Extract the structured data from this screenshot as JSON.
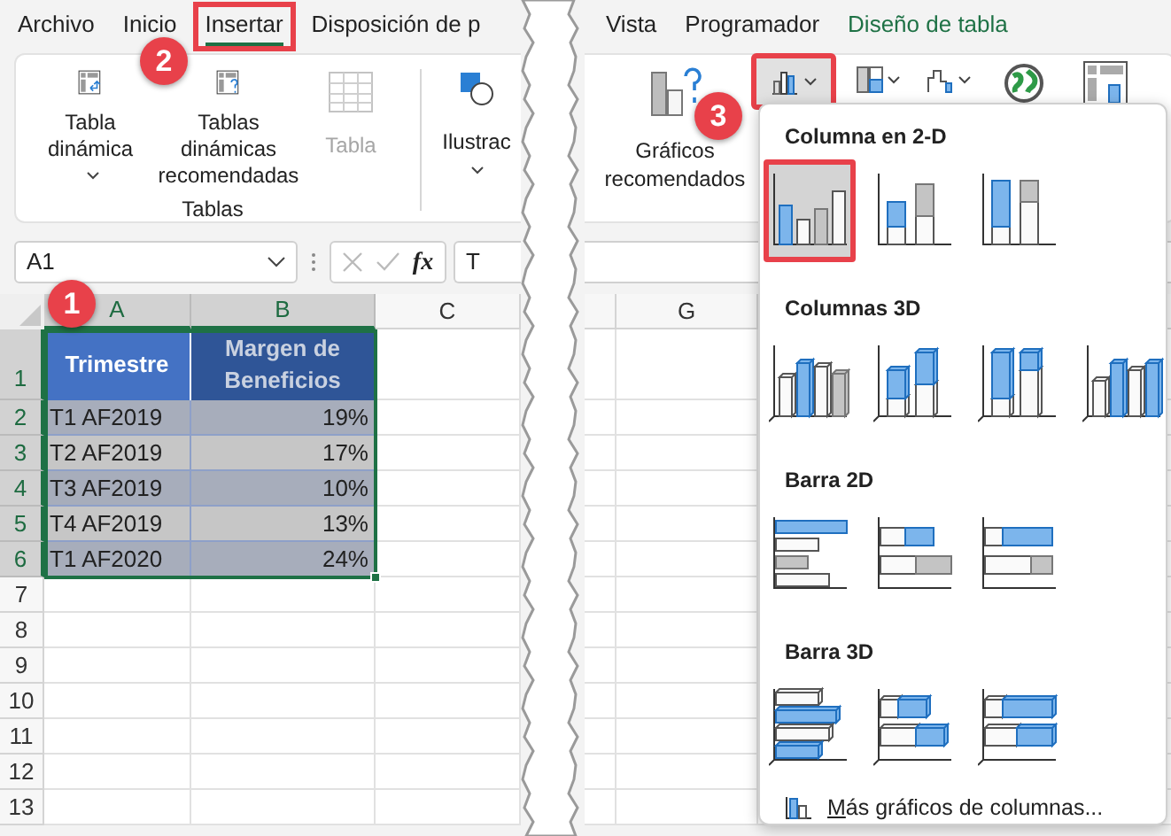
{
  "tabs": [
    {
      "label": "Archivo",
      "selected": false,
      "highlighted": false,
      "kind": "normal"
    },
    {
      "label": "Inicio",
      "selected": false,
      "highlighted": false,
      "kind": "normal"
    },
    {
      "label": "Insertar",
      "selected": true,
      "highlighted": true,
      "kind": "normal"
    },
    {
      "label": "Disposición de p",
      "selected": false,
      "highlighted": false,
      "kind": "normal"
    },
    {
      "label": "Vista",
      "selected": false,
      "highlighted": false,
      "kind": "normal"
    },
    {
      "label": "Programador",
      "selected": false,
      "highlighted": false,
      "kind": "normal"
    },
    {
      "label": "Diseño de tabla",
      "selected": false,
      "highlighted": false,
      "kind": "contextual"
    }
  ],
  "ribbon": {
    "tables_group": {
      "label": "Tablas",
      "buttons": [
        {
          "label": "Tabla dinámica",
          "dropdown": true,
          "disabled": false
        },
        {
          "label": "Tablas dinámicas recomendadas",
          "dropdown": false,
          "disabled": false
        },
        {
          "label": "Tabla",
          "dropdown": false,
          "disabled": true
        }
      ]
    },
    "illustrations": {
      "label": "Ilustrac",
      "dropdown": true
    },
    "recommended_charts": {
      "label": "Gráficos recomendados"
    },
    "column_chart_button": {
      "highlighted": true
    }
  },
  "formula_bar": {
    "name_box": "A1",
    "function_label": "fx",
    "formula": "T"
  },
  "sheet": {
    "columns": [
      {
        "label": "A",
        "selected": true
      },
      {
        "label": "B",
        "selected": true
      },
      {
        "label": "C",
        "selected": false
      },
      {
        "label": "G",
        "selected": false
      }
    ],
    "row_numbers": [
      {
        "label": "1",
        "selected": true
      },
      {
        "label": "2",
        "selected": true
      },
      {
        "label": "3",
        "selected": true
      },
      {
        "label": "4",
        "selected": true
      },
      {
        "label": "5",
        "selected": true
      },
      {
        "label": "6",
        "selected": true
      },
      {
        "label": "7",
        "selected": false
      },
      {
        "label": "8",
        "selected": false
      },
      {
        "label": "9",
        "selected": false
      },
      {
        "label": "10",
        "selected": false
      },
      {
        "label": "11",
        "selected": false
      },
      {
        "label": "12",
        "selected": false
      },
      {
        "label": "13",
        "selected": false
      }
    ],
    "table": {
      "headers": [
        "Trimestre",
        "Margen de Beneficios"
      ],
      "rows": [
        [
          "T1 AF2019",
          "19%"
        ],
        [
          "T2 AF2019",
          "17%"
        ],
        [
          "T3 AF2019",
          "10%"
        ],
        [
          "T4 AF2019",
          "13%"
        ],
        [
          "T1 AF2020",
          "24%"
        ]
      ]
    }
  },
  "chart_menu": {
    "sections": [
      {
        "title": "Columna en 2-D",
        "kind": "column2d",
        "items": [
          {
            "kind": "clustered",
            "selected": true,
            "highlighted": true
          },
          {
            "kind": "stacked",
            "selected": false,
            "highlighted": false
          },
          {
            "kind": "percent",
            "selected": false,
            "highlighted": false
          }
        ]
      },
      {
        "title": "Columnas 3D",
        "kind": "column3d",
        "items": [
          {
            "kind": "clustered",
            "selected": false,
            "highlighted": false
          },
          {
            "kind": "stacked",
            "selected": false,
            "highlighted": false
          },
          {
            "kind": "percent",
            "selected": false,
            "highlighted": false
          },
          {
            "kind": "depth",
            "selected": false,
            "highlighted": false
          }
        ]
      },
      {
        "title": "Barra 2D",
        "kind": "bar2d",
        "items": [
          {
            "kind": "clustered",
            "selected": false,
            "highlighted": false
          },
          {
            "kind": "stacked",
            "selected": false,
            "highlighted": false
          },
          {
            "kind": "percent",
            "selected": false,
            "highlighted": false
          }
        ]
      },
      {
        "title": "Barra 3D",
        "kind": "bar3d",
        "items": [
          {
            "kind": "clustered",
            "selected": false,
            "highlighted": false
          },
          {
            "kind": "stacked",
            "selected": false,
            "highlighted": false
          },
          {
            "kind": "percent",
            "selected": false,
            "highlighted": false
          }
        ]
      }
    ],
    "more_link": "Más gráficos de columnas..."
  },
  "callouts": [
    {
      "number": "1"
    },
    {
      "number": "2"
    },
    {
      "number": "3"
    }
  ]
}
